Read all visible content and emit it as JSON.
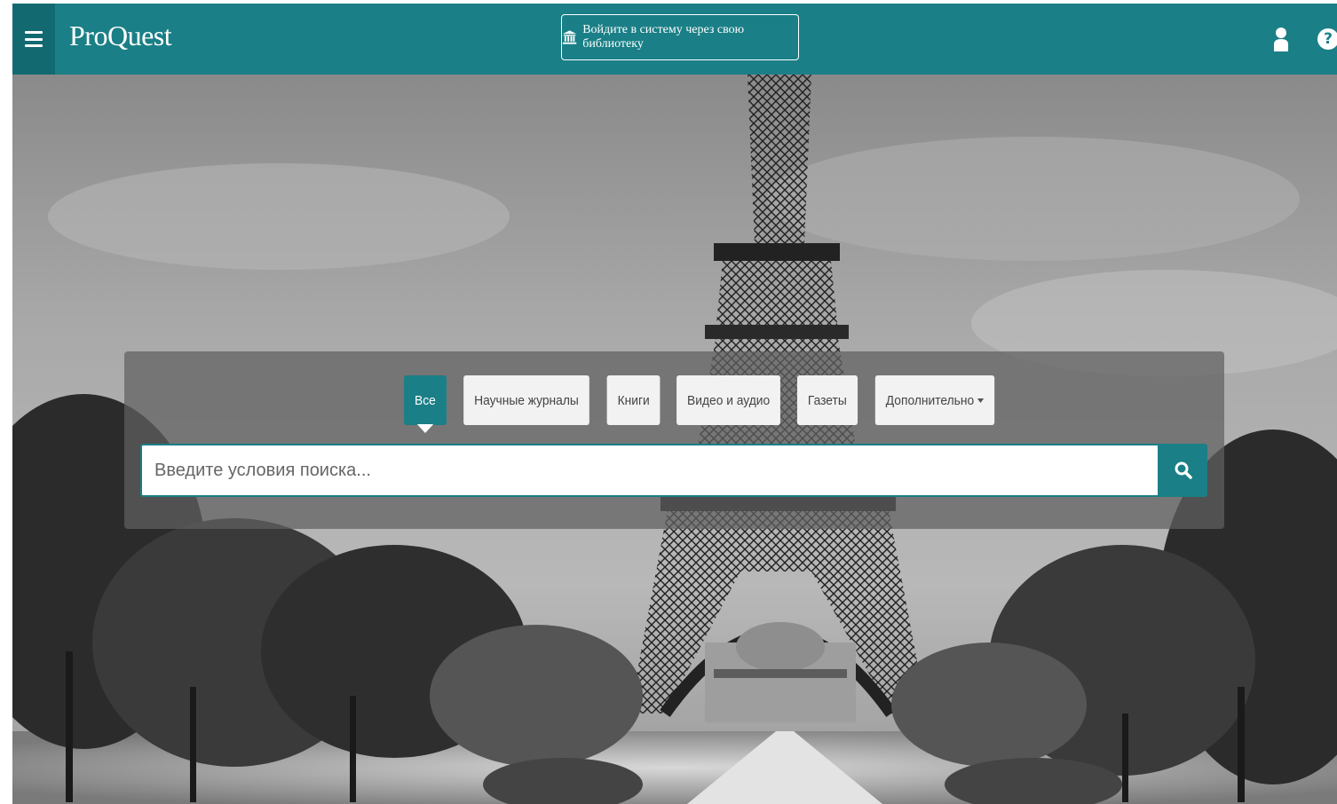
{
  "app": {
    "logo_text": "ProQuest",
    "accent_color": "#1a7f86"
  },
  "header": {
    "menu_icon": "hamburger-menu-icon",
    "library_login_label": "Войдите в систему через свою библиотеку",
    "library_icon": "institution-icon",
    "user_icon": "user-icon",
    "help_icon": "help-icon",
    "help_glyph": "?"
  },
  "search": {
    "tabs": [
      {
        "label": "Все",
        "active": true
      },
      {
        "label": "Научные журналы",
        "active": false
      },
      {
        "label": "Книги",
        "active": false
      },
      {
        "label": "Видео и аудио",
        "active": false
      },
      {
        "label": "Газеты",
        "active": false
      },
      {
        "label": "Дополнительно",
        "active": false
      }
    ],
    "placeholder": "Введите условия поиска...",
    "value": "",
    "button_icon": "search-icon"
  }
}
